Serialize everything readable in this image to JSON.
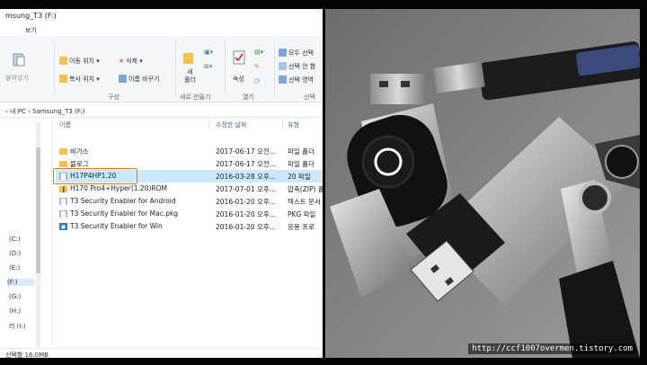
{
  "window": {
    "title": "msung_T3 (F:)"
  },
  "menu": {
    "tabs": [
      "",
      "보기"
    ]
  },
  "ribbon": {
    "paste_label": "붙여넣기",
    "move_label": "이동 위치",
    "copy_label": "복사 위치",
    "delete_label": "삭제",
    "rename_label": "이름 바꾸기",
    "organize_group": "구성",
    "new_folder_line1": "새",
    "new_folder_line2": "폴더",
    "new_group": "새로 만들기",
    "properties_label": "속성",
    "open_group": "열기",
    "select_all_label": "모두 선택",
    "select_none_label": "선택 안 함",
    "invert_selection_label": "선택 영역",
    "select_group": "선택"
  },
  "address": {
    "path": "› 내 PC › Samsung_T3 (F:)"
  },
  "nav": {
    "drives": [
      "(C:)",
      "(D:)",
      "(E:)",
      "(F:)",
      "(G:)",
      "(H:)",
      "리 (I:)"
    ]
  },
  "columns": {
    "name": "이름",
    "date": "수정한 날짜",
    "type": "유형"
  },
  "files": [
    {
      "name": "비가스",
      "date": "2017-06-17 오전...",
      "type": "파일 폴더",
      "kind": "folder"
    },
    {
      "name": "블로그",
      "date": "2017-06-17 오전...",
      "type": "파일 폴더",
      "kind": "folder"
    },
    {
      "name": "H17P4HP1.20",
      "date": "2016-03-28 오후...",
      "type": "20 파일",
      "kind": "file"
    },
    {
      "name": "H170 Pro4+Hyper(1.20)ROM",
      "date": "2017-07-01 오후...",
      "type": "압축(ZIP) 폴",
      "kind": "zip"
    },
    {
      "name": "T3 Security Enabler for Android",
      "date": "2016-01-20 오후...",
      "type": "텍스트 문서",
      "kind": "file"
    },
    {
      "name": "T3 Security Enabler for Mac.pkg",
      "date": "2016-01-20 오후...",
      "type": "PKG 파일",
      "kind": "file"
    },
    {
      "name": "T3 Security Enabler for Win",
      "date": "2016-01-20 오후...",
      "type": "응용 프로",
      "kind": "app"
    }
  ],
  "status": {
    "text": "선택함 16.0MB"
  },
  "photo": {
    "watermark": "http://ccf1007overmen.tistory.com"
  },
  "colors": {
    "selection": "#cce8ff",
    "highlight_box": "#e07a2b",
    "folder": "#f3c24b"
  }
}
